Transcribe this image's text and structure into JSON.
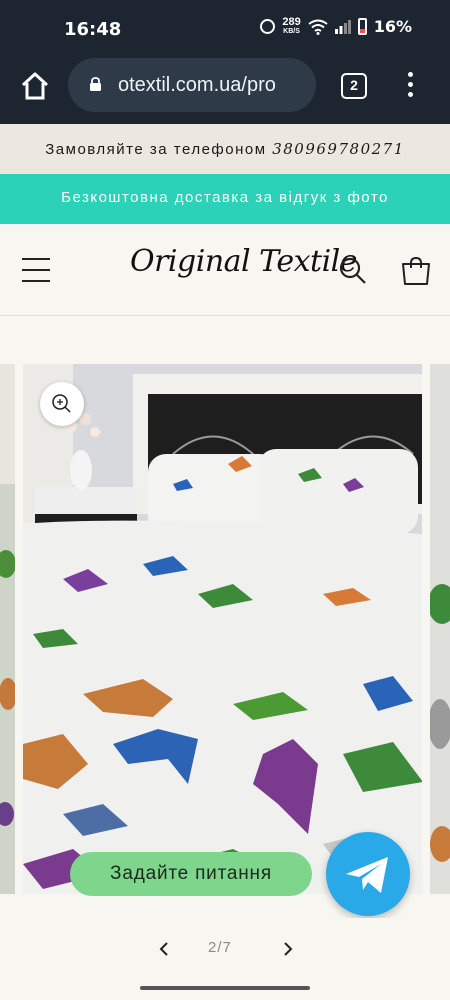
{
  "status_bar": {
    "time": "16:48",
    "speed_value": "289",
    "speed_unit": "KB/S",
    "battery": "16%"
  },
  "browser": {
    "url": "otextil.com.ua/pro",
    "tab_count": "2"
  },
  "announcements": {
    "phone_text": "Замовляйте за телефоном",
    "phone_number": "380969780271",
    "delivery_text": "Безкоштовна доставка за відгук з фото"
  },
  "header": {
    "logo_text": "Original Textile"
  },
  "chat": {
    "ask_label": "Задайте питання"
  },
  "gallery": {
    "counter": "2/7"
  },
  "colors": {
    "accent_teal": "#2bd2b8",
    "ask_green": "#7ed58c",
    "telegram_blue": "#29a9e8",
    "browser_dark": "#1c2530"
  }
}
